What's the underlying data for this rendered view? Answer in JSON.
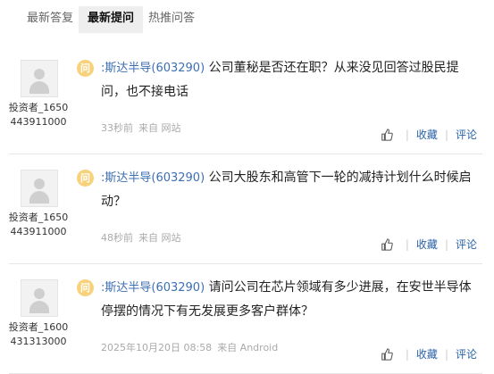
{
  "tabs": [
    "最新答复",
    "最新提问",
    "热推问答"
  ],
  "active_tab": 1,
  "ask_icon_text": "问",
  "like_icon": "thumbs-up-icon",
  "items": [
    {
      "user_line1": "投资者_1650",
      "user_line2": "443911000",
      "stock": ":斯达半导(603290)",
      "question": "公司董秘是否还在职？从来没见回答过股民提问，也不接电话",
      "time": "33秒前",
      "source": "来自 网站",
      "favorite": "收藏",
      "comment": "评论"
    },
    {
      "user_line1": "投资者_1650",
      "user_line2": "443911000",
      "stock": ":斯达半导(603290)",
      "question": "公司大股东和高管下一轮的减持计划什么时候启动？",
      "time": "48秒前",
      "source": "来自 网站",
      "favorite": "收藏",
      "comment": "评论"
    },
    {
      "user_line1": "投资者_1600",
      "user_line2": "431313000",
      "stock": ":斯达半导(603290)",
      "question": "请问公司在芯片领域有多少进展，在安世半导体停摆的情况下有无发展更多客户群体？",
      "time": "2025年10月20日 08:58",
      "source": "来自 Android",
      "favorite": "收藏",
      "comment": "评论"
    }
  ]
}
